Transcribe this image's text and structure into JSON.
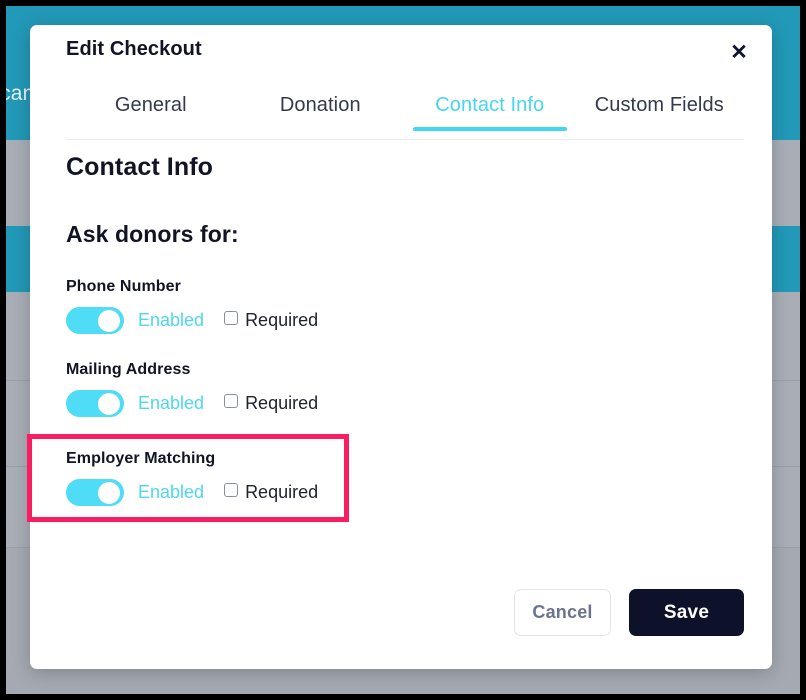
{
  "background": {
    "partial_text": "can",
    "teal_color": "#2299B8",
    "row_color": "#A9AEB6"
  },
  "modal": {
    "title": "Edit Checkout",
    "close_icon": "close-icon",
    "tabs": [
      {
        "label": "General",
        "active": false
      },
      {
        "label": "Donation",
        "active": false
      },
      {
        "label": "Contact Info",
        "active": true
      },
      {
        "label": "Custom Fields",
        "active": false
      }
    ],
    "section_title": "Contact Info",
    "ask_title": "Ask donors for:",
    "fields": [
      {
        "label": "Phone Number",
        "toggle_state": "on",
        "enabled_label": "Enabled",
        "required_label": "Required",
        "required_checked": false,
        "highlighted": false
      },
      {
        "label": "Mailing Address",
        "toggle_state": "on",
        "enabled_label": "Enabled",
        "required_label": "Required",
        "required_checked": false,
        "highlighted": false
      },
      {
        "label": "Employer Matching",
        "toggle_state": "on",
        "enabled_label": "Enabled",
        "required_label": "Required",
        "required_checked": false,
        "highlighted": true
      }
    ],
    "footer": {
      "cancel_label": "Cancel",
      "save_label": "Save"
    }
  },
  "colors": {
    "accent_cyan": "#4FDCF6",
    "tab_active": "#45D6F2",
    "save_bg": "#0D1129",
    "cancel_text": "#6C7390",
    "highlight_box": "#FA1D62",
    "heading": "#111425"
  }
}
